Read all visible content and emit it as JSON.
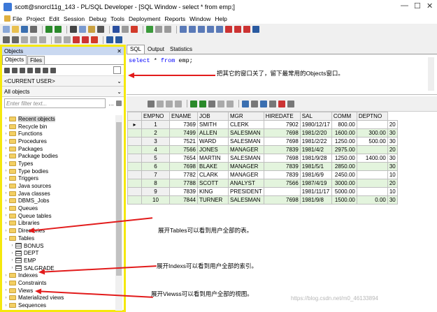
{
  "window": {
    "title": "scott@snorcl11g_143 - PL/SQL Developer - [SQL Window - select * from emp;]"
  },
  "menus": [
    "File",
    "Project",
    "Edit",
    "Session",
    "Debug",
    "Tools",
    "Deployment",
    "Reports",
    "Window",
    "Help"
  ],
  "objects_panel": {
    "title": "Objects",
    "tabs": [
      "Objects",
      "Files"
    ],
    "user_combo": "<CURRENT USER>",
    "objects_combo": "All objects",
    "filter_placeholder": "Enter filter text...",
    "tree": [
      {
        "label": "Recent objects",
        "type": "folder",
        "expanded": false
      },
      {
        "label": "Recycle bin",
        "type": "folder",
        "expanded": false
      },
      {
        "label": "Functions",
        "type": "folder",
        "expanded": false
      },
      {
        "label": "Procedures",
        "type": "folder",
        "expanded": false
      },
      {
        "label": "Packages",
        "type": "folder",
        "expanded": false
      },
      {
        "label": "Package bodies",
        "type": "folder",
        "expanded": false
      },
      {
        "label": "Types",
        "type": "folder",
        "expanded": false
      },
      {
        "label": "Type bodies",
        "type": "folder",
        "expanded": false
      },
      {
        "label": "Triggers",
        "type": "folder",
        "expanded": false
      },
      {
        "label": "Java sources",
        "type": "folder",
        "expanded": false
      },
      {
        "label": "Java classes",
        "type": "folder",
        "expanded": false
      },
      {
        "label": "DBMS_Jobs",
        "type": "folder",
        "expanded": false
      },
      {
        "label": "Queues",
        "type": "folder",
        "expanded": false
      },
      {
        "label": "Queue tables",
        "type": "folder",
        "expanded": false
      },
      {
        "label": "Libraries",
        "type": "folder",
        "expanded": false
      },
      {
        "label": "Directories",
        "type": "folder",
        "expanded": false
      },
      {
        "label": "Tables",
        "type": "folder",
        "expanded": true
      },
      {
        "label": "BONUS",
        "type": "table",
        "child": true
      },
      {
        "label": "DEPT",
        "type": "table",
        "child": true
      },
      {
        "label": "EMP",
        "type": "table",
        "child": true
      },
      {
        "label": "SALGRADE",
        "type": "table",
        "child": true
      },
      {
        "label": "Indexes",
        "type": "folder",
        "expanded": false
      },
      {
        "label": "Constraints",
        "type": "folder",
        "expanded": false
      },
      {
        "label": "Views",
        "type": "folder",
        "expanded": false
      },
      {
        "label": "Materialized views",
        "type": "folder",
        "expanded": false
      },
      {
        "label": "Sequences",
        "type": "folder",
        "expanded": false
      }
    ]
  },
  "sql_window": {
    "tabs": [
      "SQL",
      "Output",
      "Statistics"
    ],
    "query_keyword1": "select",
    "query_rest1": " * ",
    "query_keyword2": "from",
    "query_rest2": " emp;"
  },
  "result_grid": {
    "columns": [
      "EMPNO",
      "ENAME",
      "JOB",
      "MGR",
      "HIREDATE",
      "SAL",
      "COMM",
      "DEPTNO"
    ],
    "rows": [
      [
        "1",
        "7369",
        "SMITH",
        "CLERK",
        "7902",
        "1980/12/17",
        "800.00",
        "",
        "20"
      ],
      [
        "2",
        "7499",
        "ALLEN",
        "SALESMAN",
        "7698",
        "1981/2/20",
        "1600.00",
        "300.00",
        "30"
      ],
      [
        "3",
        "7521",
        "WARD",
        "SALESMAN",
        "7698",
        "1981/2/22",
        "1250.00",
        "500.00",
        "30"
      ],
      [
        "4",
        "7566",
        "JONES",
        "MANAGER",
        "7839",
        "1981/4/2",
        "2975.00",
        "",
        "20"
      ],
      [
        "5",
        "7654",
        "MARTIN",
        "SALESMAN",
        "7698",
        "1981/9/28",
        "1250.00",
        "1400.00",
        "30"
      ],
      [
        "6",
        "7698",
        "BLAKE",
        "MANAGER",
        "7839",
        "1981/5/1",
        "2850.00",
        "",
        "30"
      ],
      [
        "7",
        "7782",
        "CLARK",
        "MANAGER",
        "7839",
        "1981/6/9",
        "2450.00",
        "",
        "10"
      ],
      [
        "8",
        "7788",
        "SCOTT",
        "ANALYST",
        "7566",
        "1987/4/19",
        "3000.00",
        "",
        "20"
      ],
      [
        "9",
        "7839",
        "KING",
        "PRESIDENT",
        "",
        "1981/11/17",
        "5000.00",
        "",
        "10"
      ],
      [
        "10",
        "7844",
        "TURNER",
        "SALESMAN",
        "7698",
        "1981/9/8",
        "1500.00",
        "0.00",
        "30"
      ]
    ]
  },
  "annotations": {
    "note1": "把其它的窗口关了，留下最常用的Objects窗口。",
    "note2": "展开Tables可以看到用户全部的表。",
    "note3": "展开Indexs可以看到用户全部的索引。",
    "note4": "展开Viewss可以看到用户全部的视图。"
  },
  "watermark": "https://blog.csdn.net/m0_46133894",
  "colors": {
    "highlight_border": "#f5e80c",
    "arrow": "#e21b1b",
    "row_alt": "#e3f4dd",
    "keyword": "#0000ff"
  }
}
